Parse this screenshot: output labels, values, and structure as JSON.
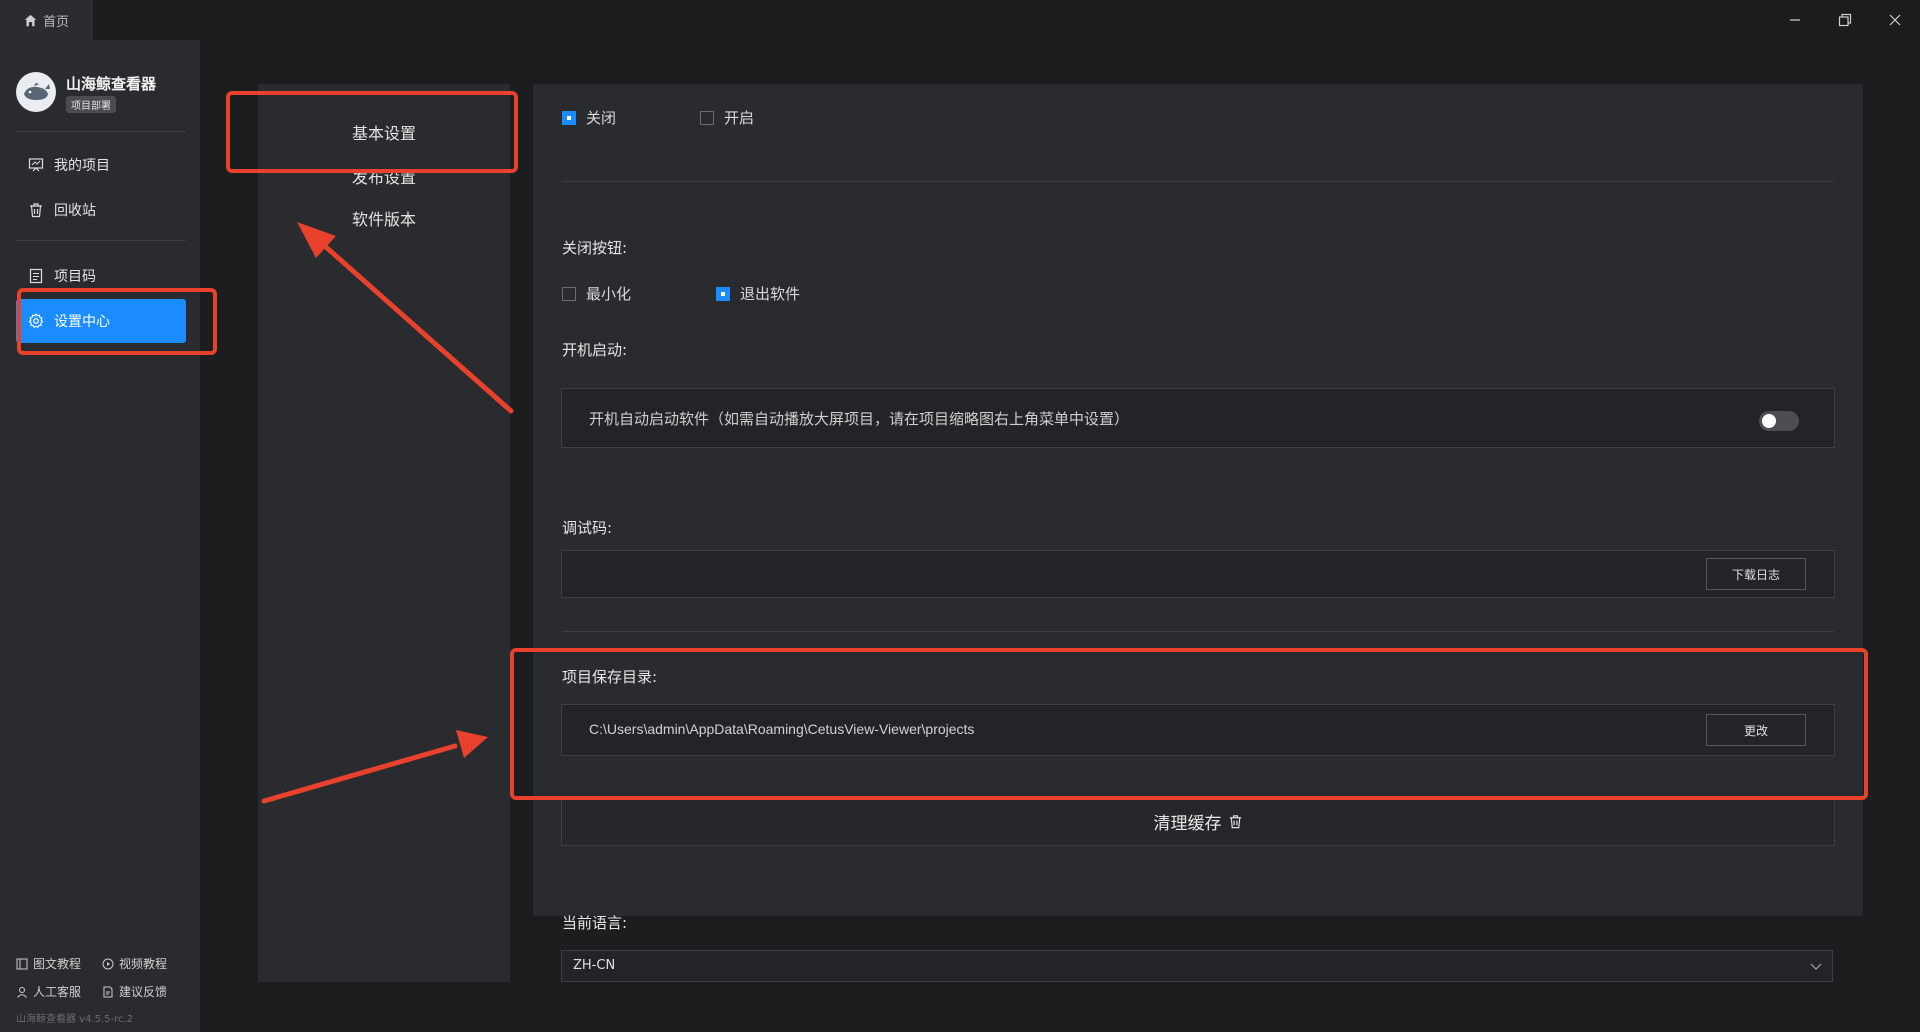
{
  "titlebar": {
    "home_tab": "首页",
    "min_icon": "minimize-icon",
    "restore_icon": "restore-icon",
    "close_icon": "close-icon"
  },
  "app": {
    "name": "山海鲸查看器",
    "badge": "项目部署",
    "version": "山海鲸查看器 v4.5.5-rc.2"
  },
  "sidebar": {
    "items": [
      {
        "label": "我的项目",
        "icon": "project-board-icon"
      },
      {
        "label": "回收站",
        "icon": "trash-icon"
      },
      {
        "label": "项目码",
        "icon": "document-icon"
      },
      {
        "label": "设置中心",
        "icon": "gear-icon",
        "active": true
      }
    ],
    "footer": [
      {
        "label": "图文教程",
        "icon": "book-icon"
      },
      {
        "label": "视频教程",
        "icon": "play-circle-icon"
      },
      {
        "label": "人工客服",
        "icon": "person-icon"
      },
      {
        "label": "建议反馈",
        "icon": "feedback-icon"
      }
    ]
  },
  "settings_nav": {
    "items": [
      {
        "label": "基本设置",
        "active": true
      },
      {
        "label": "发布设置"
      },
      {
        "label": "软件版本"
      }
    ]
  },
  "content": {
    "top_options": [
      {
        "label": "关闭",
        "checked": true
      },
      {
        "label": "开启",
        "checked": false
      }
    ],
    "close_button": {
      "label": "关闭按钮:",
      "options": [
        {
          "label": "最小化",
          "checked": false
        },
        {
          "label": "退出软件",
          "checked": true
        }
      ]
    },
    "startup": {
      "label": "开机启动:",
      "description": "开机自动启动软件（如需自动播放大屏项目，请在项目缩略图右上角菜单中设置）",
      "enabled": false
    },
    "debug": {
      "label": "调试码:",
      "button": "下载日志"
    },
    "save_dir": {
      "label": "项目保存目录:",
      "path": "C:\\Users\\admin\\AppData\\Roaming\\CetusView-Viewer\\projects",
      "button": "更改"
    },
    "clear_cache": "清理缓存",
    "language": {
      "label": "当前语言:",
      "value": "ZH-CN"
    }
  },
  "colors": {
    "accent": "#1a8cff",
    "annotation": "#e8412c",
    "background": "#1c1d1f",
    "panel": "#2a2b2e"
  }
}
